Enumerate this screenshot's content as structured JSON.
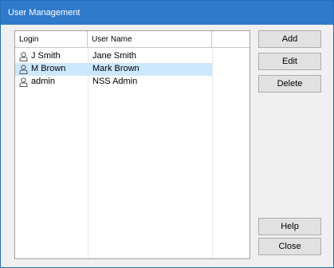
{
  "window": {
    "title": "User Management"
  },
  "list": {
    "columns": [
      "Login",
      "User Name",
      ""
    ],
    "rows": [
      {
        "login": "J Smith",
        "user_name": "Jane Smith",
        "selected": false
      },
      {
        "login": "M Brown",
        "user_name": "Mark Brown",
        "selected": true
      },
      {
        "login": "admin",
        "user_name": "NSS Admin",
        "selected": false
      }
    ],
    "row_icon": "user-icon"
  },
  "buttons": {
    "add": "Add",
    "edit": "Edit",
    "delete": "Delete",
    "help": "Help",
    "close": "Close"
  },
  "colors": {
    "titlebar": "#2f7acb",
    "selection": "#cce8ff"
  }
}
